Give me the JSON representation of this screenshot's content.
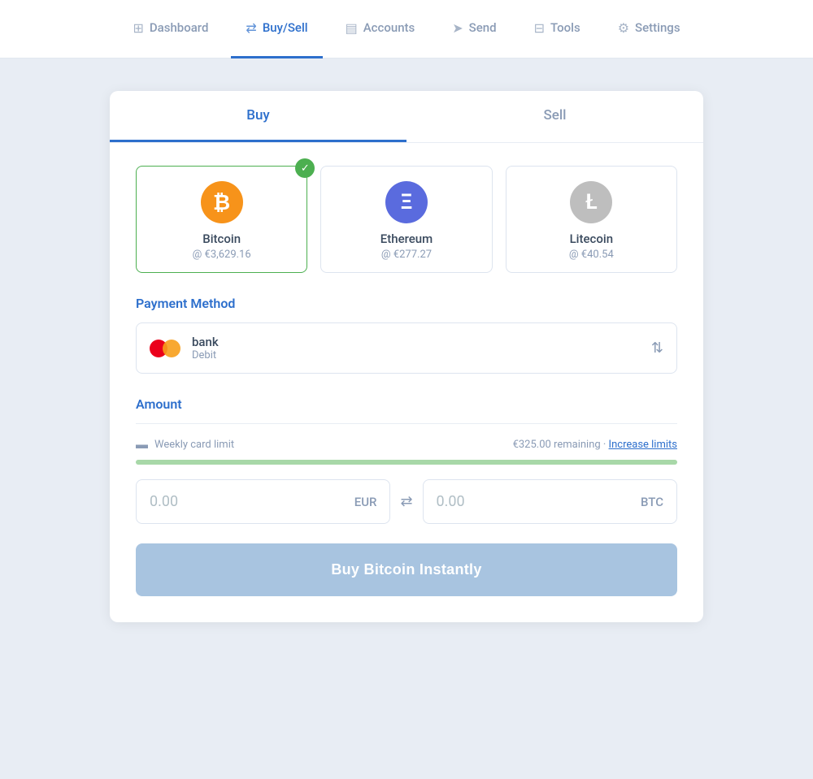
{
  "nav": {
    "items": [
      {
        "id": "dashboard",
        "label": "Dashboard",
        "icon": "⊞",
        "active": false
      },
      {
        "id": "buysell",
        "label": "Buy/Sell",
        "icon": "⇄",
        "active": true
      },
      {
        "id": "accounts",
        "label": "Accounts",
        "icon": "▤",
        "active": false
      },
      {
        "id": "send",
        "label": "Send",
        "icon": "➤",
        "active": false
      },
      {
        "id": "tools",
        "label": "Tools",
        "icon": "⊟",
        "active": false
      },
      {
        "id": "settings",
        "label": "Settings",
        "icon": "⚙",
        "active": false
      }
    ]
  },
  "tabs": [
    {
      "id": "buy",
      "label": "Buy",
      "active": true
    },
    {
      "id": "sell",
      "label": "Sell",
      "active": false
    }
  ],
  "cryptos": [
    {
      "id": "btc",
      "name": "Bitcoin",
      "price": "@ €3,629.16",
      "type": "btc",
      "selected": true,
      "symbol": "₿"
    },
    {
      "id": "eth",
      "name": "Ethereum",
      "price": "@ €277.27",
      "type": "eth",
      "selected": false,
      "symbol": "Ξ"
    },
    {
      "id": "ltc",
      "name": "Litecoin",
      "price": "@ €40.54",
      "type": "ltc",
      "selected": false,
      "symbol": "Ł"
    }
  ],
  "payment": {
    "section_label": "Payment Method",
    "method_name": "bank",
    "method_sub": "Debit"
  },
  "amount": {
    "section_label": "Amount",
    "limit_label": "Weekly card limit",
    "limit_remaining": "€325.00 remaining",
    "increase_limits": "Increase limits",
    "progress_pct": 100,
    "eur_value": "0.00",
    "eur_currency": "EUR",
    "btc_value": "0.00",
    "btc_currency": "BTC"
  },
  "buy_button_label": "Buy Bitcoin Instantly"
}
